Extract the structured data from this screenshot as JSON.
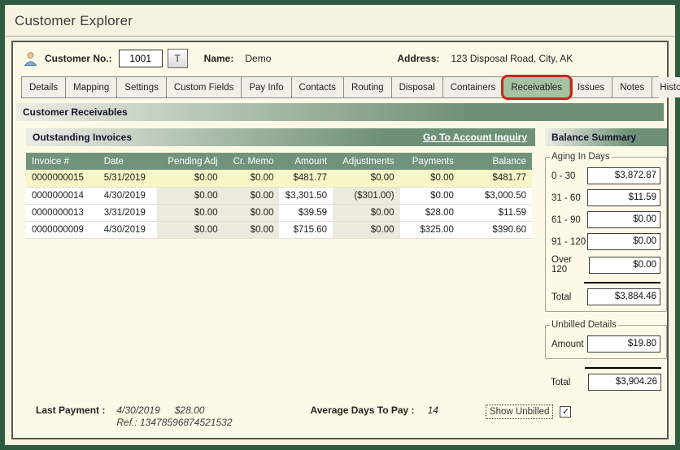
{
  "window": {
    "title": "Customer Explorer"
  },
  "customer": {
    "customer_no_label": "Customer No.:",
    "customer_no_value": "1001",
    "t_button_label": "T",
    "name_label": "Name:",
    "name_value": "Demo",
    "address_label": "Address:",
    "address_value": "123 Disposal Road, City, AK"
  },
  "tabs": [
    {
      "label": "Details",
      "active": false
    },
    {
      "label": "Mapping",
      "active": false
    },
    {
      "label": "Settings",
      "active": false
    },
    {
      "label": "Custom Fields",
      "active": false
    },
    {
      "label": "Pay Info",
      "active": false
    },
    {
      "label": "Contacts",
      "active": false
    },
    {
      "label": "Routing",
      "active": false
    },
    {
      "label": "Disposal",
      "active": false
    },
    {
      "label": "Containers",
      "active": false
    },
    {
      "label": "Receivables",
      "active": true,
      "annotated_with_red_box": true
    },
    {
      "label": "Issues",
      "active": false
    },
    {
      "label": "Notes",
      "active": false
    },
    {
      "label": "History",
      "active": false
    }
  ],
  "sections": {
    "customer_receivables": "Customer Receivables",
    "outstanding_invoices": "Outstanding Invoices",
    "go_to_account_inquiry": "Go To Account Inquiry",
    "balance_summary": "Balance Summary"
  },
  "invoice_table": {
    "headers": [
      "Invoice #",
      "Date",
      "Pending Adj",
      "Cr. Memo",
      "Amount",
      "Adjustments",
      "Payments",
      "Balance"
    ],
    "rows": [
      {
        "invoice": "0000000015",
        "date": "5/31/2019",
        "pending": "$0.00",
        "crmemo": "$0.00",
        "amount": "$481.77",
        "adjustments": "$0.00",
        "payments": "$0.00",
        "balance": "$481.77",
        "highlighted": true
      },
      {
        "invoice": "0000000014",
        "date": "4/30/2019",
        "pending": "$0.00",
        "crmemo": "$0.00",
        "amount": "$3,301.50",
        "adjustments": "($301.00)",
        "payments": "$0.00",
        "balance": "$3,000.50",
        "highlighted": false
      },
      {
        "invoice": "0000000013",
        "date": "3/31/2019",
        "pending": "$0.00",
        "crmemo": "$0.00",
        "amount": "$39.59",
        "adjustments": "$0.00",
        "payments": "$28.00",
        "balance": "$11.59",
        "highlighted": false
      },
      {
        "invoice": "0000000009",
        "date": "4/30/2019",
        "pending": "$0.00",
        "crmemo": "$0.00",
        "amount": "$715.60",
        "adjustments": "$0.00",
        "payments": "$325.00",
        "balance": "$390.60",
        "highlighted": false
      }
    ]
  },
  "aging": {
    "legend": "Aging In Days",
    "rows": [
      {
        "label": "0 - 30",
        "value": "$3,872.87"
      },
      {
        "label": "31 - 60",
        "value": "$11.59"
      },
      {
        "label": "61 - 90",
        "value": "$0.00"
      },
      {
        "label": "91 - 120",
        "value": "$0.00"
      },
      {
        "label": "Over 120",
        "value": "$0.00"
      }
    ],
    "total_label": "Total",
    "total_value": "$3,884.46"
  },
  "unbilled": {
    "legend": "Unbilled Details",
    "amount_label": "Amount",
    "amount_value": "$19.80"
  },
  "grand_total": {
    "label": "Total",
    "value": "$3,904.26"
  },
  "footer": {
    "last_payment_label": "Last Payment :",
    "last_payment_date": "4/30/2019",
    "last_payment_amount": "$28.00",
    "ref_value": "Ref.: 13478596874521532",
    "avg_days_label": "Average Days To Pay :",
    "avg_days_value": "14",
    "show_unbilled_label": "Show Unbilled",
    "show_unbilled_checked": true
  },
  "colors": {
    "frame_green": "#2d5c40",
    "panel_cream": "#fcfae6",
    "header_green": "#71937c",
    "active_tab_green": "#a7c2a2",
    "annotation_red": "#d02418",
    "highlight_row_yellow": "#f8f6c6",
    "shaded_column_beige": "#edeadd"
  }
}
